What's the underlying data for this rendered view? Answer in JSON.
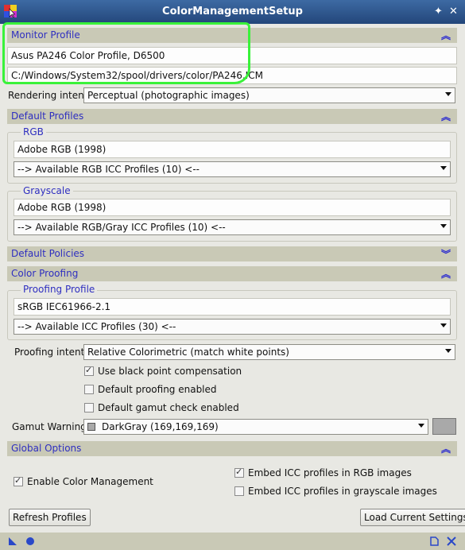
{
  "window": {
    "title": "ColorManagementSetup"
  },
  "monitor_profile": {
    "header": "Monitor Profile",
    "profile_name": "Asus PA246 Color Profile, D6500",
    "profile_path": "C:/Windows/System32/spool/drivers/color/PA246.ICM",
    "rendering_intent_label": "Rendering intent:",
    "rendering_intent_value": "Perceptual (photographic images)"
  },
  "default_profiles": {
    "header": "Default Profiles",
    "rgb": {
      "title": "RGB",
      "value": "Adobe RGB (1998)",
      "list": "--> Available RGB ICC Profiles (10) <--"
    },
    "grayscale": {
      "title": "Grayscale",
      "value": "Adobe RGB (1998)",
      "list": "--> Available RGB/Gray ICC Profiles (10) <--"
    }
  },
  "default_policies": {
    "header": "Default Policies"
  },
  "color_proofing": {
    "header": "Color Proofing",
    "proofing_profile": {
      "title": "Proofing Profile",
      "value": "sRGB IEC61966-2.1",
      "list": "--> Available ICC Profiles (30) <--"
    },
    "proofing_intent_label": "Proofing intent:",
    "proofing_intent_value": "Relative Colorimetric (match white points)",
    "black_point": {
      "label": "Use black point compensation",
      "checked": true
    },
    "default_proofing": {
      "label": "Default proofing enabled",
      "checked": false
    },
    "default_gamut": {
      "label": "Default gamut check enabled",
      "checked": false
    },
    "gamut_warning_label": "Gamut Warning:",
    "gamut_warning_value": "DarkGray (169,169,169)",
    "gamut_color": "#a9a9a9"
  },
  "global_options": {
    "header": "Global Options",
    "enable_cm": {
      "label": "Enable Color Management",
      "checked": true
    },
    "embed_rgb": {
      "label": "Embed ICC profiles in RGB images",
      "checked": true
    },
    "embed_gray": {
      "label": "Embed ICC profiles in grayscale images",
      "checked": false
    }
  },
  "buttons": {
    "refresh": "Refresh Profiles",
    "load": "Load Current Settings"
  },
  "colors": {
    "title_bar": "#2e5790",
    "section_header": "#c9c9b6",
    "section_text": "#2f2fc0",
    "highlight": "#3af23a"
  }
}
